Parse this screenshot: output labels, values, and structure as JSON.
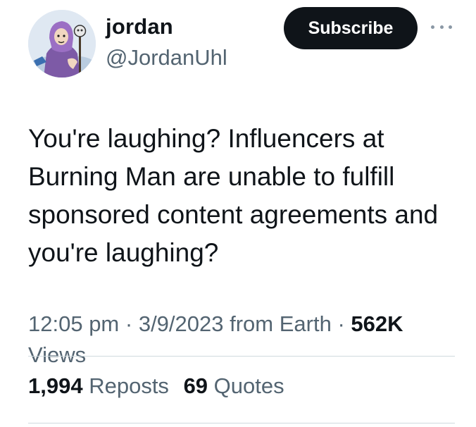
{
  "author": {
    "display_name": "jordan",
    "handle": "@JordanUhl"
  },
  "header": {
    "subscribe_label": "Subscribe",
    "more_icon": "more-horizontal-icon"
  },
  "tweet": {
    "text": "You're laughing? Influencers at Burning Man are unable to fulfill sponsored content agreements and you're laughing?"
  },
  "meta": {
    "time": "12:05 pm",
    "date": "3/9/2023",
    "source": "from Earth",
    "views_count": "562K",
    "views_label": "Views"
  },
  "stats": {
    "reposts_count": "1,994",
    "reposts_label": "Reposts",
    "quotes_count": "69",
    "quotes_label": "Quotes"
  },
  "colors": {
    "text_primary": "#0f1419",
    "text_secondary": "#536471",
    "button_bg": "#0f1419",
    "divider": "#cfd9de"
  }
}
